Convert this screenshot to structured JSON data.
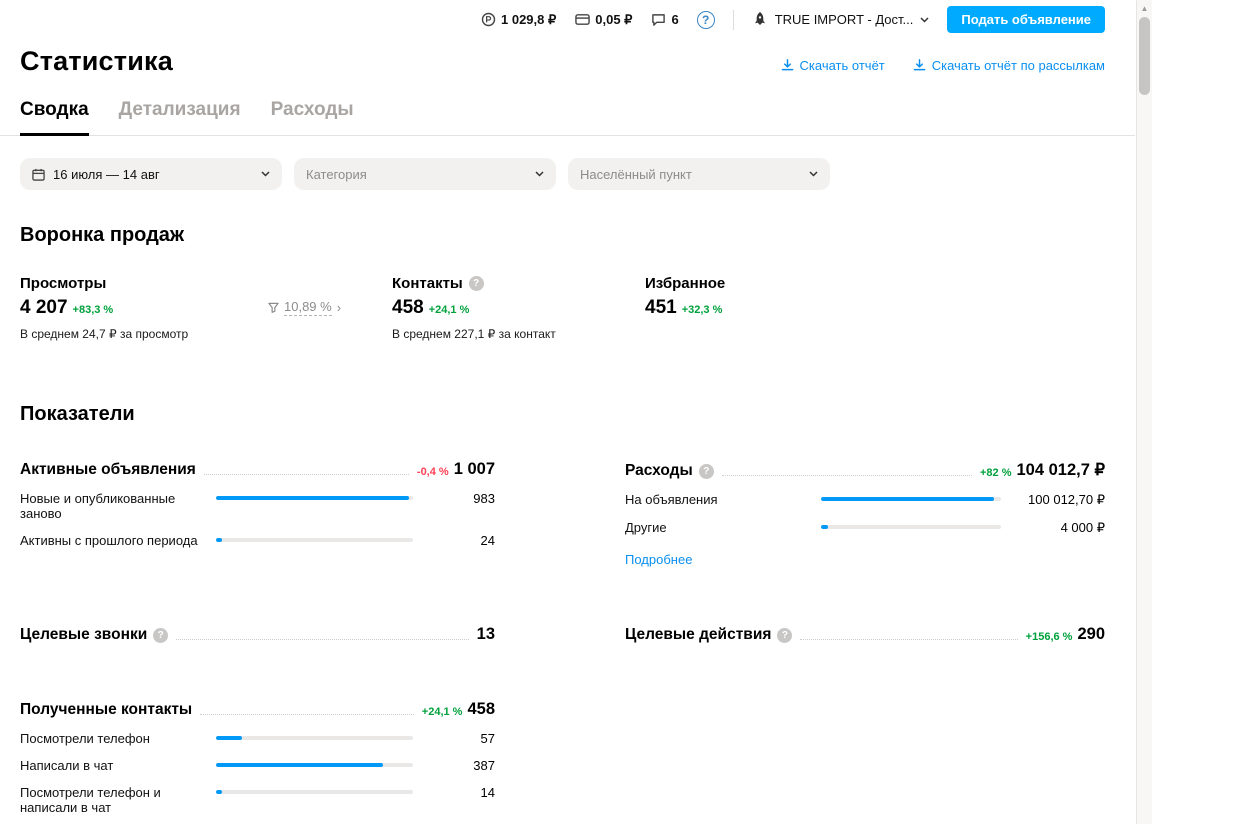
{
  "colors": {
    "accent_blue": "#00aaff",
    "link_blue": "#0a8ff0",
    "bar_blue": "#0099f7",
    "positive_green": "#00a13c",
    "negative_red": "#ff4053"
  },
  "topbar": {
    "balance": "1 029,8 ₽",
    "bonus": "0,05 ₽",
    "messages_count": "6",
    "account": "TRUE IMPORT - Дост...",
    "post_ad": "Подать объявление"
  },
  "header": {
    "title": "Статистика",
    "download_report": "Скачать отчёт",
    "download_mailing_report": "Скачать отчёт по рассылкам"
  },
  "tabs": [
    {
      "label": "Сводка"
    },
    {
      "label": "Детализация"
    },
    {
      "label": "Расходы"
    }
  ],
  "filters": {
    "date_range": "16 июля — 14 авг",
    "category_placeholder": "Категория",
    "location_placeholder": "Населённый пункт"
  },
  "funnel": {
    "title": "Воронка продаж",
    "views": {
      "label": "Просмотры",
      "value": "4 207",
      "delta": "+83,3 %",
      "note": "В среднем 24,7 ₽ за просмотр"
    },
    "conversion": "10,89 %",
    "contacts": {
      "label": "Контакты",
      "value": "458",
      "delta": "+24,1 %",
      "note": "В среднем 227,1 ₽ за контакт"
    },
    "favorites": {
      "label": "Избранное",
      "value": "451",
      "delta": "+32,3 %"
    }
  },
  "metrics": {
    "title": "Показатели",
    "active_ads": {
      "title": "Активные объявления",
      "delta": "-0,4 %",
      "value": "1 007",
      "rows": [
        {
          "label": "Новые и опубликованные заново",
          "value": "983",
          "pct": 98
        },
        {
          "label": "Активны с прошлого периода",
          "value": "24",
          "pct": 3
        }
      ]
    },
    "expenses": {
      "title": "Расходы",
      "delta": "+82 %",
      "value": "104 012,7 ₽",
      "rows": [
        {
          "label": "На объявления",
          "value": "100 012,70 ₽",
          "pct": 96
        },
        {
          "label": "Другие",
          "value": "4 000 ₽",
          "pct": 4
        }
      ],
      "more_link": "Подробнее"
    },
    "target_calls": {
      "title": "Целевые звонки",
      "value": "13"
    },
    "target_actions": {
      "title": "Целевые действия",
      "delta": "+156,6 %",
      "value": "290"
    },
    "received_contacts": {
      "title": "Полученные контакты",
      "delta": "+24,1 %",
      "value": "458",
      "rows": [
        {
          "label": "Посмотрели телефон",
          "value": "57",
          "pct": 13
        },
        {
          "label": "Написали в чат",
          "value": "387",
          "pct": 85
        },
        {
          "label": "Посмотрели телефон и написали в чат",
          "value": "14",
          "pct": 3
        }
      ]
    }
  }
}
